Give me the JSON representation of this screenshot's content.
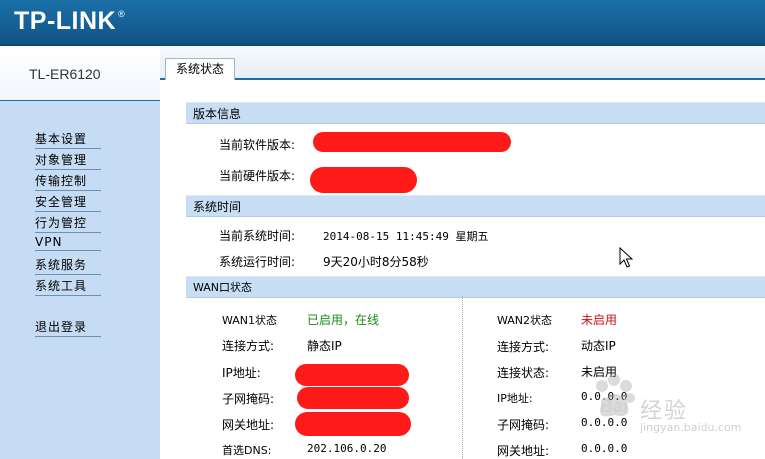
{
  "header": {
    "logo": "TP-LINK",
    "logo_mark": "®"
  },
  "model": "TL-ER6120",
  "tabs": [
    {
      "label": "系统状态"
    }
  ],
  "sidebar": {
    "items": [
      {
        "label": "基本设置"
      },
      {
        "label": "对象管理"
      },
      {
        "label": "传输控制"
      },
      {
        "label": "安全管理"
      },
      {
        "label": "行为管控"
      },
      {
        "label": "VPN"
      },
      {
        "label": "系统服务"
      },
      {
        "label": "系统工具"
      }
    ],
    "logout": "退出登录"
  },
  "version": {
    "title": "版本信息",
    "software_label": "当前软件版本:",
    "hardware_label": "当前硬件版本:"
  },
  "system_time": {
    "title": "系统时间",
    "current_label": "当前系统时间:",
    "current_value": "2014-08-15 11:45:49 星期五",
    "uptime_label": "系统运行时间:",
    "uptime_value": "9天20小时8分58秒"
  },
  "wan": {
    "title": "WAN口状态",
    "wan1": {
      "status_label": "WAN1状态",
      "status_value": "已启用，在线",
      "conn_label": "连接方式:",
      "conn_value": "静态IP",
      "ip_label": "IP地址:",
      "mask_label": "子网掩码:",
      "gw_label": "网关地址:",
      "dns_label": "首选DNS:",
      "dns_value": "202.106.0.20"
    },
    "wan2": {
      "status_label": "WAN2状态",
      "status_value": "未启用",
      "conn_label": "连接方式:",
      "conn_value": "动态IP",
      "conn_status_label": "连接状态:",
      "conn_status_value": "未启用",
      "ip_label": "IP地址:",
      "ip_value": "0.0.0.0",
      "mask_label": "子网掩码:",
      "mask_value": "0.0.0.0",
      "gw_label": "网关地址:",
      "gw_value": "0.0.0.0"
    }
  },
  "watermark": {
    "text": "经验",
    "url": "jingyan.baidu.com",
    "brand": "Bai"
  },
  "colors": {
    "header": "#1a6fa8",
    "sidebar": "#c6dcf4",
    "section": "#c8def5",
    "online": "#1a8a1a",
    "disabled": "#d01010",
    "redaction": "#ff1a1a"
  }
}
